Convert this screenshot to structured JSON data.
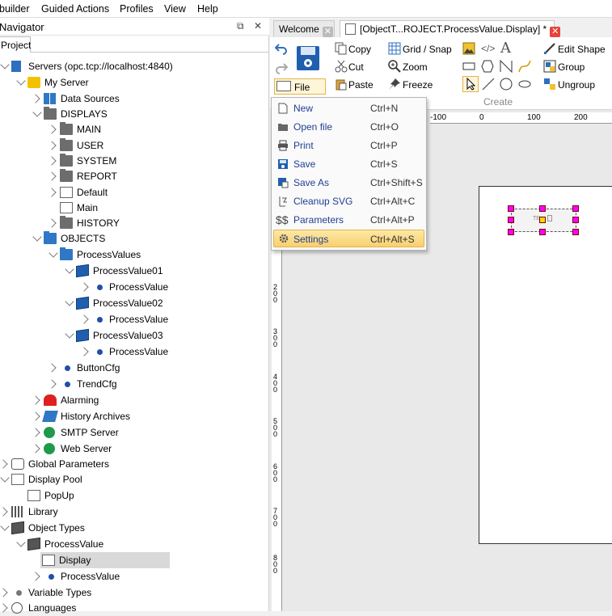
{
  "menubar": [
    "builder",
    "Guided Actions",
    "Profiles",
    "View",
    "Help"
  ],
  "navigator": {
    "title": "Navigator",
    "pin_glyph": "⧉",
    "close_glyph": "✕",
    "tab": "Project",
    "tree": [
      {
        "label": "Servers (opc.tcp://localhost:4840)",
        "icon": "server-icon",
        "state": "expanded"
      },
      {
        "label": "My Server",
        "icon": "server-yellow-icon",
        "state": "expanded"
      },
      {
        "label": "Data Sources",
        "icon": "data-grid-icon",
        "state": "collapsed"
      },
      {
        "label": "DISPLAYS",
        "icon": "folder-icon",
        "state": "expanded"
      },
      {
        "label": "MAIN",
        "icon": "folder-icon",
        "state": "collapsed"
      },
      {
        "label": "USER",
        "icon": "folder-icon",
        "state": "collapsed"
      },
      {
        "label": "SYSTEM",
        "icon": "folder-icon",
        "state": "collapsed"
      },
      {
        "label": "REPORT",
        "icon": "folder-icon",
        "state": "collapsed"
      },
      {
        "label": "Default",
        "icon": "page-icon",
        "state": "collapsed"
      },
      {
        "label": "Main",
        "icon": "page-icon",
        "state": "leaf"
      },
      {
        "label": "HISTORY",
        "icon": "folder-icon",
        "state": "collapsed"
      },
      {
        "label": "OBJECTS",
        "icon": "folder-blue-icon",
        "state": "expanded"
      },
      {
        "label": "ProcessValues",
        "icon": "folder-blue-icon",
        "state": "expanded"
      },
      {
        "label": "ProcessValue01",
        "icon": "cube-icon",
        "state": "expanded"
      },
      {
        "label": "ProcessValue",
        "icon": "dot-icon",
        "state": "collapsed"
      },
      {
        "label": "ProcessValue02",
        "icon": "cube-icon",
        "state": "expanded"
      },
      {
        "label": "ProcessValue",
        "icon": "dot-icon",
        "state": "collapsed"
      },
      {
        "label": "ProcessValue03",
        "icon": "cube-icon",
        "state": "expanded"
      },
      {
        "label": "ProcessValue",
        "icon": "dot-icon",
        "state": "collapsed"
      },
      {
        "label": "ButtonCfg",
        "icon": "dot-icon",
        "state": "collapsed"
      },
      {
        "label": "TrendCfg",
        "icon": "dot-icon",
        "state": "collapsed"
      },
      {
        "label": "Alarming",
        "icon": "alarm-icon",
        "state": "collapsed"
      },
      {
        "label": "History Archives",
        "icon": "archive-icon",
        "state": "collapsed"
      },
      {
        "label": "SMTP Server",
        "icon": "globe-icon",
        "state": "collapsed"
      },
      {
        "label": "Web Server",
        "icon": "globe-icon",
        "state": "collapsed"
      },
      {
        "label": "Global Parameters",
        "icon": "camera-icon",
        "state": "collapsed"
      },
      {
        "label": "Display Pool",
        "icon": "pages-icon",
        "state": "expanded"
      },
      {
        "label": "PopUp",
        "icon": "page-icon",
        "state": "leaf"
      },
      {
        "label": "Library",
        "icon": "library-icon",
        "state": "collapsed"
      },
      {
        "label": "Object Types",
        "icon": "cube-gray-icon",
        "state": "expanded"
      },
      {
        "label": "ProcessValue",
        "icon": "cube-gray-icon",
        "state": "expanded"
      },
      {
        "label": "Display",
        "icon": "page-icon",
        "state": "leaf",
        "selected": true
      },
      {
        "label": "ProcessValue",
        "icon": "dot-icon",
        "state": "collapsed"
      },
      {
        "label": "Variable Types",
        "icon": "dot-gray-icon",
        "state": "collapsed"
      },
      {
        "label": "Languages",
        "icon": "language-icon",
        "state": "collapsed"
      }
    ]
  },
  "tabs": [
    {
      "label": "Welcome",
      "close": "✕",
      "active": false
    },
    {
      "label": "[ObjectT...ROJECT.ProcessValue.Display] *",
      "close": "✕",
      "active": true
    }
  ],
  "ribbon": {
    "copy": "Copy",
    "cut": "Cut",
    "paste": "Paste",
    "grid_snap": "Grid / Snap",
    "zoom": "Zoom",
    "freeze": "Freeze",
    "edit_shape": "Edit Shape",
    "group": "Group",
    "ungroup": "Ungroup",
    "file": "File",
    "create_group": "Create",
    "code_glyph": "</>",
    "text_glyph": "A"
  },
  "file_menu": [
    {
      "label": "New",
      "shortcut": "Ctrl+N",
      "icon": "new-file-icon"
    },
    {
      "label": "Open file",
      "shortcut": "Ctrl+O",
      "icon": "open-folder-icon"
    },
    {
      "label": "Print",
      "shortcut": "Ctrl+P",
      "icon": "printer-icon"
    },
    {
      "label": "Save",
      "shortcut": "Ctrl+S",
      "icon": "save-icon"
    },
    {
      "label": "Save As",
      "shortcut": "Ctrl+Shift+S",
      "icon": "save-as-icon"
    },
    {
      "label": "Cleanup SVG",
      "shortcut": "Ctrl+Alt+C",
      "icon": "cleanup-icon"
    },
    {
      "label": "Parameters",
      "shortcut": "Ctrl+Alt+P",
      "icon": "parameters-icon",
      "glyph": "$$"
    },
    {
      "label": "Settings",
      "shortcut": "Ctrl+Alt+S",
      "icon": "gear-icon",
      "highlighted": true
    }
  ],
  "ruler": {
    "h_labels": [
      "-100",
      "0",
      "100",
      "200"
    ],
    "v_labels": [
      "200",
      "300",
      "400",
      "500",
      "600",
      "700",
      "800"
    ]
  },
  "shape_label": "TE"
}
